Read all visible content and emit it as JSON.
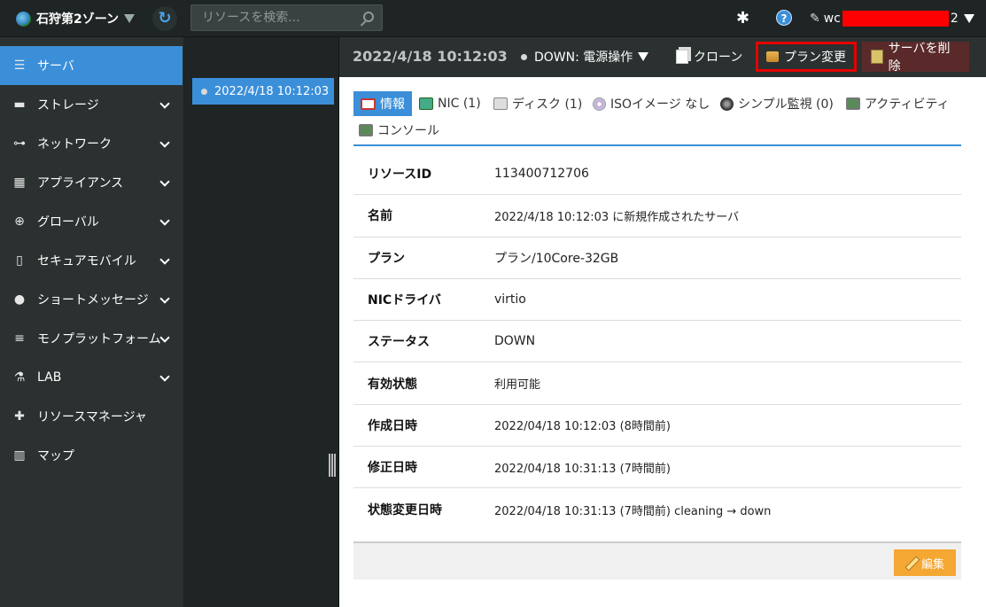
{
  "topbar": {
    "zone_label": "石狩第2ゾーン",
    "search_placeholder": "リソースを検索...",
    "user_prefix": "wc",
    "user_suffix": "2"
  },
  "sidebar": {
    "items": [
      {
        "label": "サーバ",
        "icon": "server-icon",
        "active": true
      },
      {
        "label": "ストレージ",
        "icon": "storage-icon"
      },
      {
        "label": "ネットワーク",
        "icon": "network-icon"
      },
      {
        "label": "アプライアンス",
        "icon": "appliance-icon"
      },
      {
        "label": "グローバル",
        "icon": "globe-icon"
      },
      {
        "label": "セキュアモバイル",
        "icon": "mobile-icon"
      },
      {
        "label": "ショートメッセージ",
        "icon": "chat-icon"
      },
      {
        "label": "モノプラットフォーム",
        "icon": "stack-icon"
      },
      {
        "label": "LAB",
        "icon": "flask-icon"
      },
      {
        "label": "リソースマネージャ",
        "icon": "puzzle-icon"
      },
      {
        "label": "マップ",
        "icon": "map-icon"
      }
    ]
  },
  "server_list": {
    "items": [
      {
        "label": "2022/4/18 10:12:03"
      }
    ]
  },
  "toolbar": {
    "title_time": "2022/4/18 10:12:03",
    "status_label": "DOWN: 電源操作",
    "clone_label": "クローン",
    "plan_change_label": "プラン変更",
    "delete_label": "サーバを削除"
  },
  "tabs": [
    {
      "label": "情報",
      "icon": "info-icon",
      "active": true
    },
    {
      "label": "NIC (1)",
      "icon": "nic-icon"
    },
    {
      "label": "ディスク (1)",
      "icon": "disk-icon"
    },
    {
      "label": "ISOイメージ なし",
      "icon": "iso-icon"
    },
    {
      "label": "シンプル監視 (0)",
      "icon": "monitor-icon"
    },
    {
      "label": "アクティビティ",
      "icon": "activity-icon"
    },
    {
      "label": "コンソール",
      "icon": "console-icon"
    }
  ],
  "details": [
    {
      "key": "リソースID",
      "value": "113400712706"
    },
    {
      "key": "名前",
      "value": "2022/4/18 10:12:03 に新規作成されたサーバ"
    },
    {
      "key": "プラン",
      "value": "プラン/10Core-32GB"
    },
    {
      "key": "NICドライバ",
      "value": "virtio"
    },
    {
      "key": "ステータス",
      "value": "DOWN"
    },
    {
      "key": "有効状態",
      "value": "利用可能"
    },
    {
      "key": "作成日時",
      "value": "2022/04/18 10:12:03 (8時間前)"
    },
    {
      "key": "修正日時",
      "value": "2022/04/18 10:31:13 (7時間前)"
    },
    {
      "key": "状態変更日時",
      "value": "2022/04/18 10:31:13 (7時間前) cleaning → down"
    }
  ],
  "footer": {
    "edit_label": "編集"
  },
  "colors": {
    "accent": "#3b8fd9",
    "sidebar_bg": "#2b3130",
    "highlight_border": "#e60000",
    "edit_button": "#f5a733"
  }
}
